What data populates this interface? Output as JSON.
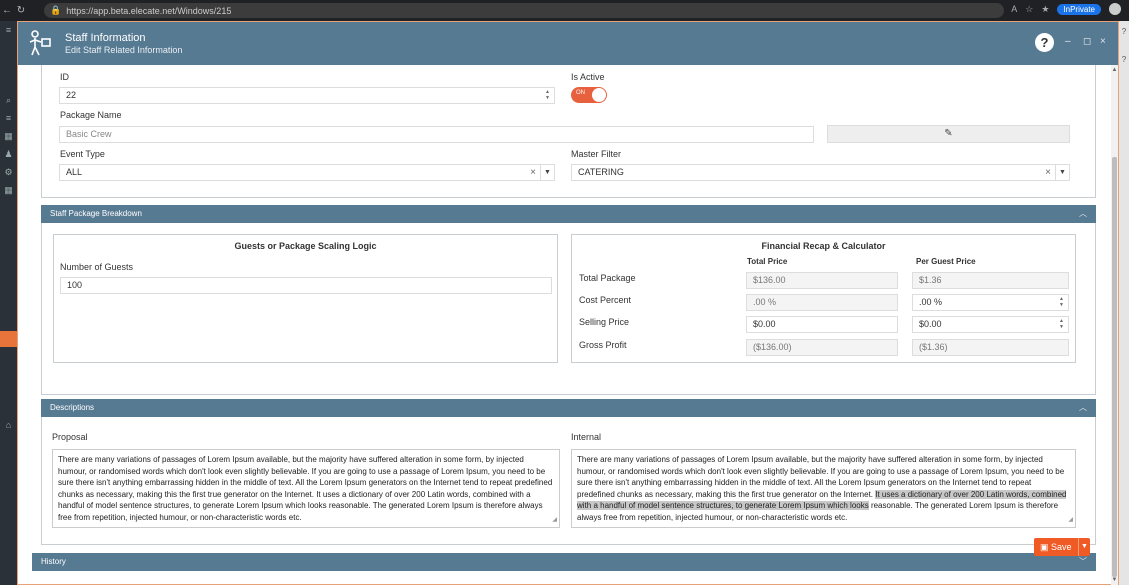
{
  "browser": {
    "url": "https://app.beta.elecate.net/Windows/215",
    "inprivate_label": "InPrivate",
    "nav_icons": [
      "back-icon",
      "refresh-icon",
      "lock-icon"
    ]
  },
  "modal": {
    "title": "Staff Information",
    "subtitle": "Edit Staff Related Information",
    "help_symbol": "?",
    "minimize_symbol": "–",
    "maximize_symbol": "◻",
    "close_symbol": "×"
  },
  "form": {
    "id_label": "ID",
    "id_value": "22",
    "is_active_label": "Is Active",
    "toggle_label": "ON",
    "package_name_label": "Package Name",
    "package_name_value": "Basic Crew",
    "event_type_label": "Event Type",
    "event_type_value": "ALL",
    "master_filter_label": "Master Filter",
    "master_filter_value": "CATERING"
  },
  "breakdown": {
    "header": "Staff Package Breakdown",
    "scaling_title": "Guests or Package Scaling Logic",
    "guests_label": "Number of Guests",
    "guests_value": "100",
    "recap_title": "Financial Recap & Calculator",
    "col_total": "Total Price",
    "col_per_guest": "Per Guest Price",
    "rows": [
      {
        "label": "Total Package",
        "total": "$136.00",
        "per_guest": "$1.36"
      },
      {
        "label": "Cost Percent",
        "total": ".00 %",
        "per_guest": ".00 %"
      },
      {
        "label": "Selling Price",
        "total": "$0.00",
        "per_guest": "$0.00"
      },
      {
        "label": "Gross Profit",
        "total": "($136.00)",
        "per_guest": "($1.36)"
      }
    ]
  },
  "descriptions": {
    "header": "Descriptions",
    "proposal_label": "Proposal",
    "proposal_text": "There are many variations of passages of Lorem Ipsum available, but the majority have suffered alteration in some form, by injected humour, or randomised words which don't look even slightly believable. If you are going to use a passage of Lorem Ipsum, you need to be sure there isn't anything embarrassing hidden in the middle of text. All the Lorem Ipsum generators on the Internet tend to repeat predefined chunks as necessary, making this the first true generator on the Internet. It uses a dictionary of over 200 Latin words, combined with a handful of model sentence structures, to generate Lorem Ipsum which looks reasonable. The generated Lorem Ipsum is therefore always free from repetition, injected humour, or non-characteristic words etc.",
    "internal_label": "Internal",
    "internal_text_before": "There are many variations of passages of Lorem Ipsum available, but the majority have suffered alteration in some form, by injected humour, or randomised words which don't look even slightly believable. If you are going to use a passage of Lorem Ipsum, you need to be sure there isn't anything embarrassing hidden in the middle of text. All the Lorem Ipsum generators on the Internet tend to repeat predefined chunks as necessary, making this the first true generator on the Internet. ",
    "internal_text_selected": "It uses a dictionary of over 200 Latin words, combined with a handful of model sentence structures, to generate Lorem Ipsum which looks",
    "internal_text_after": " reasonable. The generated Lorem Ipsum is therefore always free from repetition, injected humour, or non-characteristic words etc."
  },
  "history": {
    "header": "History"
  },
  "footer": {
    "save_label": "Save"
  },
  "colors": {
    "header_bg": "#577a93",
    "accent_orange": "#f05a24",
    "toggle_on": "#e8613f",
    "modal_border": "#e7a27a"
  }
}
